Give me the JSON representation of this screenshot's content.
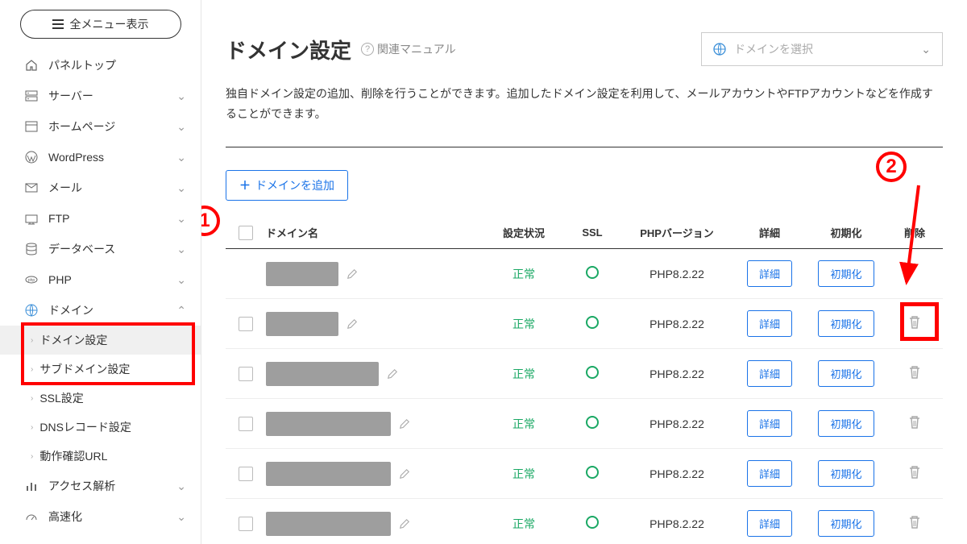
{
  "all_menu_label": "全メニュー表示",
  "sidebar": {
    "items": [
      {
        "icon": "home",
        "label": "パネルトップ",
        "expandable": false
      },
      {
        "icon": "server",
        "label": "サーバー",
        "expandable": true
      },
      {
        "icon": "window",
        "label": "ホームページ",
        "expandable": true
      },
      {
        "icon": "wordpress",
        "label": "WordPress",
        "expandable": true
      },
      {
        "icon": "mail",
        "label": "メール",
        "expandable": true
      },
      {
        "icon": "ftp",
        "label": "FTP",
        "expandable": true
      },
      {
        "icon": "db",
        "label": "データベース",
        "expandable": true
      },
      {
        "icon": "php",
        "label": "PHP",
        "expandable": true
      },
      {
        "icon": "globe",
        "label": "ドメイン",
        "expandable": true,
        "expanded": true
      },
      {
        "icon": "chart",
        "label": "アクセス解析",
        "expandable": true
      },
      {
        "icon": "speed",
        "label": "高速化",
        "expandable": true
      }
    ],
    "domain_sub": [
      {
        "label": "ドメイン設定",
        "active": true
      },
      {
        "label": "サブドメイン設定",
        "active": false
      },
      {
        "label": "SSL設定",
        "active": false
      },
      {
        "label": "DNSレコード設定",
        "active": false
      },
      {
        "label": "動作確認URL",
        "active": false
      }
    ]
  },
  "page": {
    "title": "ドメイン設定",
    "manual_label": "関連マニュアル",
    "domain_select_placeholder": "ドメインを選択",
    "description": "独自ドメイン設定の追加、削除を行うことができます。追加したドメイン設定を利用して、メールアカウントやFTPアカウントなどを作成することができます。",
    "add_button": "ドメインを追加"
  },
  "table": {
    "headers": {
      "name": "ドメイン名",
      "status": "設定状況",
      "ssl": "SSL",
      "php": "PHPバージョン",
      "detail": "詳細",
      "init": "初期化",
      "delete": "削除"
    },
    "status_ok": "正常",
    "detail_btn": "詳細",
    "init_btn": "初期化",
    "rows": [
      {
        "checkbox": false,
        "redacted_w": 90,
        "php": "PHP8.2.22",
        "deletable": false
      },
      {
        "checkbox": true,
        "redacted_w": 90,
        "php": "PHP8.2.22",
        "deletable": true,
        "highlight_delete": true
      },
      {
        "checkbox": true,
        "redacted_w": 140,
        "php": "PHP8.2.22",
        "deletable": true
      },
      {
        "checkbox": true,
        "redacted_w": 155,
        "php": "PHP8.2.22",
        "deletable": true
      },
      {
        "checkbox": true,
        "redacted_w": 155,
        "php": "PHP8.2.22",
        "deletable": true
      },
      {
        "checkbox": true,
        "redacted_w": 155,
        "php": "PHP8.2.22",
        "deletable": true
      }
    ]
  },
  "annotations": {
    "one": "1",
    "two": "2"
  }
}
